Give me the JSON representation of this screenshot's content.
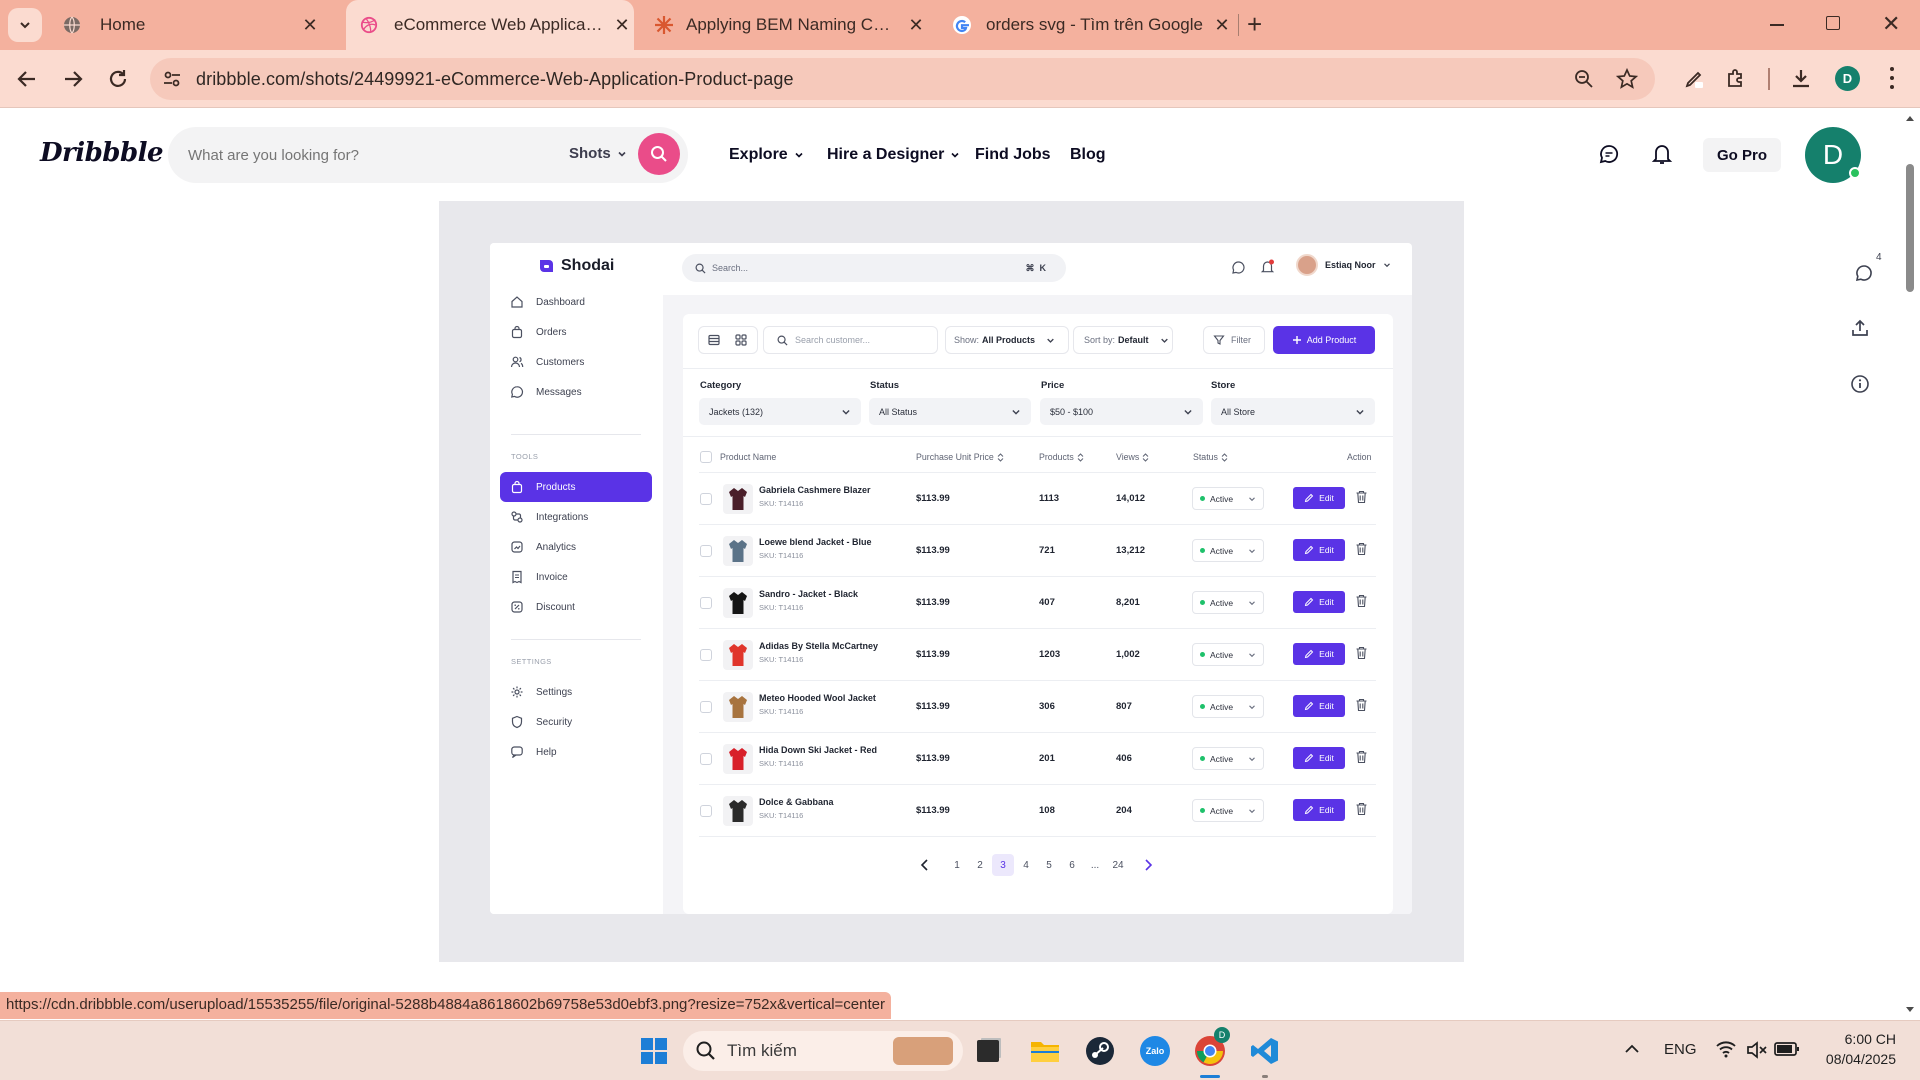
{
  "browser": {
    "tabs": [
      {
        "title": "Home",
        "icon": "globe-icon"
      },
      {
        "title": "eCommerce Web Application -",
        "icon": "dribbble-icon",
        "active": true
      },
      {
        "title": "Applying BEM Naming Convent",
        "icon": "asterisk-icon"
      },
      {
        "title": "orders svg - Tìm trên Google",
        "icon": "google-icon"
      }
    ],
    "url": "dribbble.com/shots/24499921-eCommerce-Web-Application-Product-page",
    "profile_letter": "D",
    "status_url": "https://cdn.dribbble.com/userupload/15535255/file/original-5288b4884a8618602b69758e53d0ebf3.png?resize=752x&vertical=center"
  },
  "dribbble": {
    "logo": "Dribbble",
    "search_placeholder": "What are you looking for?",
    "search_scope": "Shots",
    "nav": [
      "Explore",
      "Hire a Designer",
      "Find Jobs",
      "Blog"
    ],
    "go_pro": "Go Pro",
    "avatar_letter": "D",
    "comments_count": "4",
    "accent": "#ea4c89"
  },
  "app": {
    "brand": "Shodai",
    "search_placeholder": "Search...",
    "search_shortcut": "⌘  K",
    "user_name": "Estiaq Noor",
    "accent": "#5a33e6",
    "menu_main": [
      "Dashboard",
      "Orders",
      "Customers",
      "Messages"
    ],
    "section_tools": "TOOLS",
    "menu_tools": [
      "Products",
      "Integrations",
      "Analytics",
      "Invoice",
      "Discount"
    ],
    "section_settings": "SETTINGS",
    "menu_settings": [
      "Settings",
      "Security",
      "Help"
    ],
    "toolbar": {
      "search_placeholder": "Search customer...",
      "show_label": "Show:",
      "show_value": "All Products",
      "sort_label": "Sort by:",
      "sort_value": "Default",
      "filter": "Filter",
      "add_product": "Add Product"
    },
    "filters": [
      {
        "label": "Category",
        "value": "Jackets (132)"
      },
      {
        "label": "Status",
        "value": "All Status"
      },
      {
        "label": "Price",
        "value": "$50 - $100"
      },
      {
        "label": "Store",
        "value": "All Store"
      }
    ],
    "columns": {
      "name": "Product Name",
      "price": "Purchase Unit Price",
      "products": "Products",
      "views": "Views",
      "status": "Status",
      "action": "Action"
    },
    "rows": [
      {
        "name": "Gabriela Cashmere Blazer",
        "sku": "SKU: T14116",
        "price": "$113.99",
        "products": "1113",
        "views": "14,012",
        "status": "Active",
        "color": "#4a1f2a"
      },
      {
        "name": "Loewe blend Jacket - Blue",
        "sku": "SKU: T14116",
        "price": "$113.99",
        "products": "721",
        "views": "13,212",
        "status": "Active",
        "color": "#5b7388"
      },
      {
        "name": "Sandro - Jacket - Black",
        "sku": "SKU: T14116",
        "price": "$113.99",
        "products": "407",
        "views": "8,201",
        "status": "Active",
        "color": "#151515"
      },
      {
        "name": "Adidas By Stella McCartney",
        "sku": "SKU: T14116",
        "price": "$113.99",
        "products": "1203",
        "views": "1,002",
        "status": "Active",
        "color": "#e0352b"
      },
      {
        "name": "Meteo Hooded Wool Jacket",
        "sku": "SKU: T14116",
        "price": "$113.99",
        "products": "306",
        "views": "807",
        "status": "Active",
        "color": "#a8743f"
      },
      {
        "name": "Hida Down Ski Jacket - Red",
        "sku": "SKU: T14116",
        "price": "$113.99",
        "products": "201",
        "views": "406",
        "status": "Active",
        "color": "#d8202a"
      },
      {
        "name": "Dolce & Gabbana",
        "sku": "SKU: T14116",
        "price": "$113.99",
        "products": "108",
        "views": "204",
        "status": "Active",
        "color": "#2a2a2a"
      }
    ],
    "edit_label": "Edit",
    "pagination": {
      "pages": [
        "1",
        "2",
        "3",
        "4",
        "5",
        "6",
        "...",
        "24"
      ],
      "current": "3"
    }
  },
  "taskbar": {
    "search_placeholder": "Tìm kiếm",
    "lang": "ENG",
    "time": "6:00 CH",
    "date": "08/04/2025"
  }
}
